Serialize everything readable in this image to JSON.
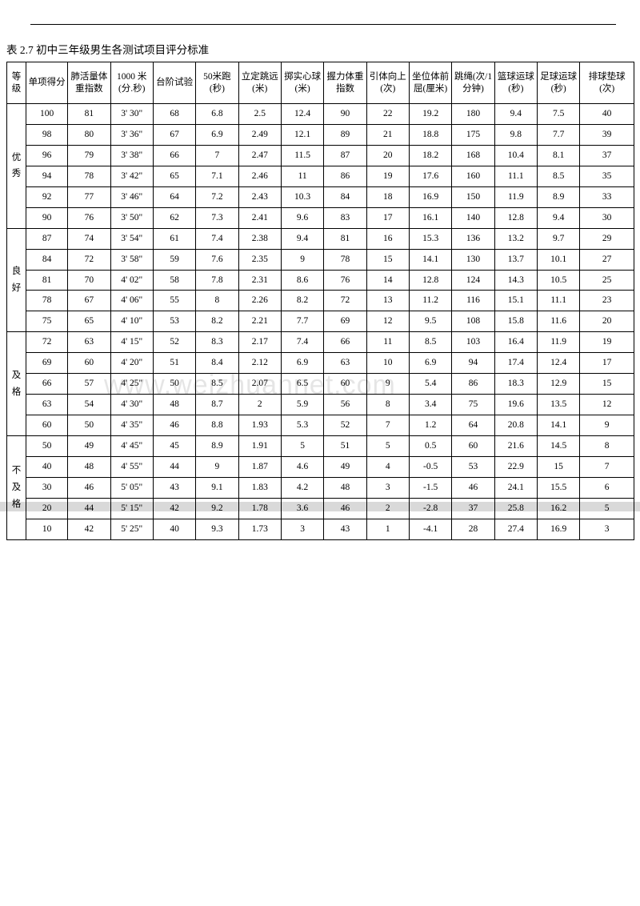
{
  "title": "表 2.7 初中三年级男生各测试项目评分标准",
  "watermark": "www.weizhuannet.com",
  "headers": {
    "grade": "等级",
    "score": "单项得分",
    "vital": "肺活量体重指数",
    "m1000": "1000 米(分.秒)",
    "step": "台阶试验",
    "m50": "50米跑(秒)",
    "jump": "立定跳远(米)",
    "ball": "掷实心球(米)",
    "grip": "握力体重指数",
    "pullup": "引体向上(次)",
    "sitreach": "坐位体前屈(厘米)",
    "rope": "跳绳(次/1分钟)",
    "bball": "篮球运球(秒)",
    "fball": "足球运球(秒)",
    "vball": "排球垫球(次)"
  },
  "chart_data": {
    "type": "table",
    "groups": [
      {
        "label": "优秀",
        "span": 6
      },
      {
        "label": "良好",
        "span": 5
      },
      {
        "label": "及格",
        "span": 5
      },
      {
        "label": "不及格",
        "span": 5
      }
    ],
    "rows": [
      [
        "100",
        "81",
        "3' 30\"",
        "68",
        "6.8",
        "2.5",
        "12.4",
        "90",
        "22",
        "19.2",
        "180",
        "9.4",
        "7.5",
        "40"
      ],
      [
        "98",
        "80",
        "3' 36\"",
        "67",
        "6.9",
        "2.49",
        "12.1",
        "89",
        "21",
        "18.8",
        "175",
        "9.8",
        "7.7",
        "39"
      ],
      [
        "96",
        "79",
        "3' 38\"",
        "66",
        "7",
        "2.47",
        "11.5",
        "87",
        "20",
        "18.2",
        "168",
        "10.4",
        "8.1",
        "37"
      ],
      [
        "94",
        "78",
        "3' 42\"",
        "65",
        "7.1",
        "2.46",
        "11",
        "86",
        "19",
        "17.6",
        "160",
        "11.1",
        "8.5",
        "35"
      ],
      [
        "92",
        "77",
        "3' 46\"",
        "64",
        "7.2",
        "2.43",
        "10.3",
        "84",
        "18",
        "16.9",
        "150",
        "11.9",
        "8.9",
        "33"
      ],
      [
        "90",
        "76",
        "3' 50\"",
        "62",
        "7.3",
        "2.41",
        "9.6",
        "83",
        "17",
        "16.1",
        "140",
        "12.8",
        "9.4",
        "30"
      ],
      [
        "87",
        "74",
        "3' 54\"",
        "61",
        "7.4",
        "2.38",
        "9.4",
        "81",
        "16",
        "15.3",
        "136",
        "13.2",
        "9.7",
        "29"
      ],
      [
        "84",
        "72",
        "3' 58\"",
        "59",
        "7.6",
        "2.35",
        "9",
        "78",
        "15",
        "14.1",
        "130",
        "13.7",
        "10.1",
        "27"
      ],
      [
        "81",
        "70",
        "4' 02\"",
        "58",
        "7.8",
        "2.31",
        "8.6",
        "76",
        "14",
        "12.8",
        "124",
        "14.3",
        "10.5",
        "25"
      ],
      [
        "78",
        "67",
        "4' 06\"",
        "55",
        "8",
        "2.26",
        "8.2",
        "72",
        "13",
        "11.2",
        "116",
        "15.1",
        "11.1",
        "23"
      ],
      [
        "75",
        "65",
        "4' 10\"",
        "53",
        "8.2",
        "2.21",
        "7.7",
        "69",
        "12",
        "9.5",
        "108",
        "15.8",
        "11.6",
        "20"
      ],
      [
        "72",
        "63",
        "4' 15\"",
        "52",
        "8.3",
        "2.17",
        "7.4",
        "66",
        "11",
        "8.5",
        "103",
        "16.4",
        "11.9",
        "19"
      ],
      [
        "69",
        "60",
        "4' 20\"",
        "51",
        "8.4",
        "2.12",
        "6.9",
        "63",
        "10",
        "6.9",
        "94",
        "17.4",
        "12.4",
        "17"
      ],
      [
        "66",
        "57",
        "4' 25\"",
        "50",
        "8.5",
        "2.07",
        "6.5",
        "60",
        "9",
        "5.4",
        "86",
        "18.3",
        "12.9",
        "15"
      ],
      [
        "63",
        "54",
        "4' 30\"",
        "48",
        "8.7",
        "2",
        "5.9",
        "56",
        "8",
        "3.4",
        "75",
        "19.6",
        "13.5",
        "12"
      ],
      [
        "60",
        "50",
        "4' 35\"",
        "46",
        "8.8",
        "1.93",
        "5.3",
        "52",
        "7",
        "1.2",
        "64",
        "20.8",
        "14.1",
        "9"
      ],
      [
        "50",
        "49",
        "4' 45\"",
        "45",
        "8.9",
        "1.91",
        "5",
        "51",
        "5",
        "0.5",
        "60",
        "21.6",
        "14.5",
        "8"
      ],
      [
        "40",
        "48",
        "4' 55\"",
        "44",
        "9",
        "1.87",
        "4.6",
        "49",
        "4",
        "-0.5",
        "53",
        "22.9",
        "15",
        "7"
      ],
      [
        "30",
        "46",
        "5' 05\"",
        "43",
        "9.1",
        "1.83",
        "4.2",
        "48",
        "3",
        "-1.5",
        "46",
        "24.1",
        "15.5",
        "6"
      ],
      [
        "20",
        "44",
        "5' 15\"",
        "42",
        "9.2",
        "1.78",
        "3.6",
        "46",
        "2",
        "-2.8",
        "37",
        "25.8",
        "16.2",
        "5"
      ],
      [
        "10",
        "42",
        "5' 25\"",
        "40",
        "9.3",
        "1.73",
        "3",
        "43",
        "1",
        "-4.1",
        "28",
        "27.4",
        "16.9",
        "3"
      ]
    ]
  }
}
